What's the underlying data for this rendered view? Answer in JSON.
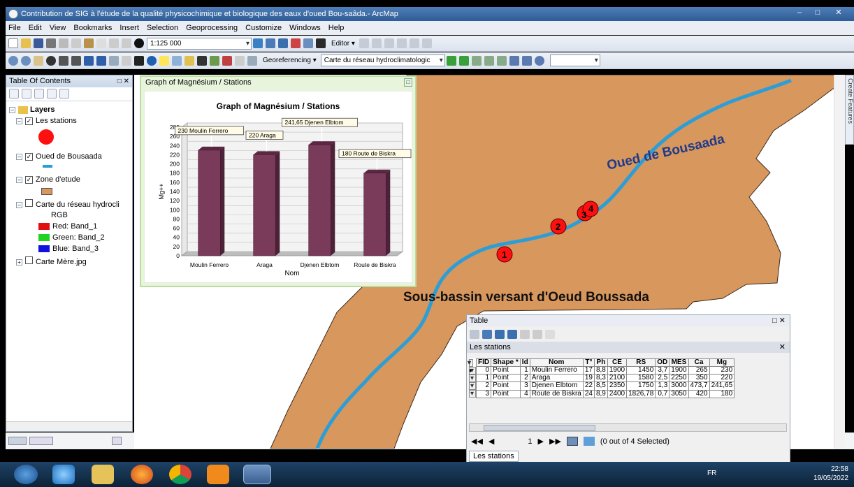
{
  "window": {
    "title": "Contribution de SIG à l'étude de la qualité physicochimique et biologique des eaux d'oued  Bou-saâda.- ArcMap"
  },
  "menu": [
    "File",
    "Edit",
    "View",
    "Bookmarks",
    "Insert",
    "Selection",
    "Geoprocessing",
    "Customize",
    "Windows",
    "Help"
  ],
  "toolbar": {
    "scale": "1:125 000",
    "editor": "Editor ▾",
    "georef": "Georeferencing ▾",
    "layer_select": "Carte du réseau hydroclimatologic"
  },
  "toc": {
    "title": "Table Of Contents",
    "layers_label": "Layers",
    "items": [
      {
        "label": "Les stations"
      },
      {
        "label": "Oued de Bousaada"
      },
      {
        "label": "Zone d'etude"
      },
      {
        "label": "Carte du réseau hydrocli"
      },
      {
        "label": "RGB"
      },
      {
        "label": "Red:  Band_1"
      },
      {
        "label": "Green:  Band_2"
      },
      {
        "label": "Blue:  Band_3"
      },
      {
        "label": "Carte Mère.jpg"
      }
    ],
    "colors": {
      "station": "#ff1010",
      "oued": "#2b9ed8",
      "zone": "#d8975c",
      "red": "#e01010",
      "green": "#22d422",
      "blue": "#1010e0"
    }
  },
  "map": {
    "label_oued": "Oued de Bousaada",
    "label_basin": "Sous-bassin versant d'Oeud Boussada",
    "stations": [
      "1",
      "2",
      "3",
      "4"
    ],
    "basin_color": "#d8975c",
    "river_color": "#2b9ed8"
  },
  "graph": {
    "window_title": "Graph of Magnésium / Stations",
    "close": "□"
  },
  "chart_data": {
    "type": "bar",
    "title": "Graph of Magnésium / Stations",
    "categories": [
      "Moulin Ferrero",
      "Araga",
      "Djenen Elbtom",
      "Route de Biskra"
    ],
    "values": [
      230,
      220,
      241.65,
      180
    ],
    "data_labels": [
      "230 Moulin Ferrero",
      "220 Araga",
      "241,65 Djenen Elbtom",
      "180 Route de Biskra"
    ],
    "xlabel": "Nom",
    "ylabel": "Mg++",
    "ylim": [
      0,
      280
    ],
    "yticks": [
      "0",
      "20",
      "40",
      "60",
      "80",
      "100",
      "120",
      "140",
      "160",
      "180",
      "200",
      "220",
      "240",
      "260",
      "280"
    ],
    "bar_color": "#7a3a5a",
    "grid": true
  },
  "table": {
    "window_title": "Table",
    "subtitle": "Les stations",
    "columns": [
      "FID",
      "Shape *",
      "Id",
      "Nom",
      "T°",
      "Ph",
      "CE",
      "RS",
      "OD",
      "MES",
      "Ca",
      "Mg"
    ],
    "rows": [
      [
        "0",
        "Point",
        "1",
        "Moulin Ferrero",
        "17",
        "8,8",
        "1900",
        "1450",
        "3,7",
        "1900",
        "265",
        "230"
      ],
      [
        "1",
        "Point",
        "2",
        "Araga",
        "19",
        "8,3",
        "2100",
        "1580",
        "2,5",
        "2250",
        "350",
        "220"
      ],
      [
        "2",
        "Point",
        "3",
        "Djenen Elbtom",
        "22",
        "8,5",
        "2350",
        "1750",
        "1,3",
        "3000",
        "473,7",
        "241,65"
      ],
      [
        "3",
        "Point",
        "4",
        "Route de Biskra",
        "24",
        "8,9",
        "2400",
        "1826,78",
        "0,7",
        "3050",
        "420",
        "180"
      ]
    ],
    "nav_record": "1",
    "selected_text": "(0 out of 4 Selected)",
    "tab_label": "Les stations"
  },
  "side_tab": "Create Features",
  "tray": {
    "lang": "FR",
    "time": "22:58",
    "date": "19/05/2022"
  }
}
